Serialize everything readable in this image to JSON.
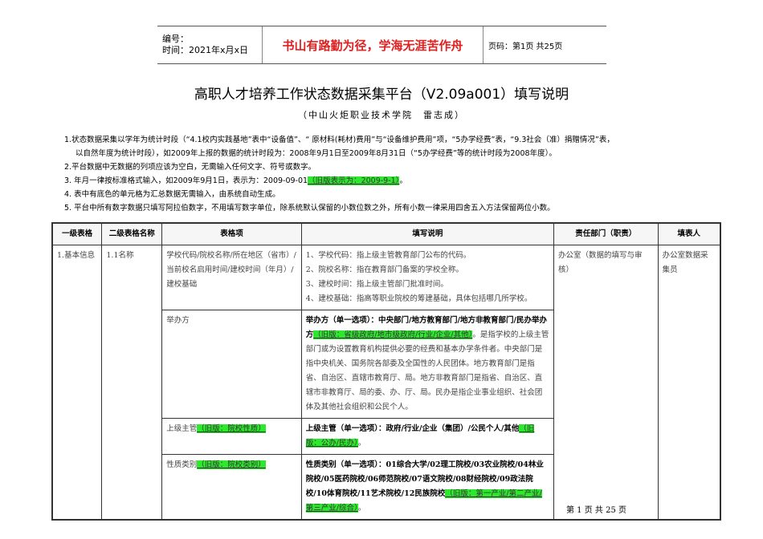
{
  "header": {
    "number_label": "编号：",
    "time_label": "时间：2021年x月x日",
    "motto": "书山有路勤为径，学海无涯苦作舟",
    "page_info": "页码：第1页  共25页"
  },
  "title": "高职人才培养工作状态数据采集平台（V2.09a001）填写说明",
  "subtitle": "（中山火炬职业技术学院　雷志成）",
  "notes": [
    "1.状态数据采集以学年为统计时段（“4.1校内实践基地”表中“设备值”、“ 原材料(耗材)费用”与“设备维护费用”项，“5办学经费”表，“9.3社会（准）捐赠情况”表，",
    "以自然年度为统计时段），如2009年上报的数据的统计时段为：2008年9月1日至2009年8月31日（“5办学经费”等的统计时段为2008年度）。",
    "2.平台数据中无数据的列项应该为空白，无需输入任何文字、符号或数字。",
    "3.  年月一律按标准格式输入，如2009年9月1日，表示为：2009-09-01",
    "（旧版表示为：2009-9-1）",
    "。",
    "4.  表中有底色的单元格为汇总数据无需输入，由系统自动生成。",
    "5.  平台中所有数字数据只填写阿拉伯数字，不用填写数字单位，除系统默认保留的小数位数之外，所有小数一律采用四舍五入方法保留两位小数。"
  ],
  "table": {
    "headers": [
      "一级表格",
      "二级表格名称",
      "表格项",
      "填写说明",
      "责任部门（职责）",
      "填表人"
    ],
    "level1": "1.基本信息",
    "level2": "1.1名称",
    "dept": "办公室（数据的填写与审核）",
    "filler": "办公室数据采集员",
    "rows": [
      {
        "item": "学校代码/院校名称/所在地区（省市）/当前校名启用时间/建校时间（年月）/建校基础",
        "desc": [
          "1、学校代码：指上级主管教育部门公布的代码。",
          "2、院校名称：指在教育部门备案的学校全称。",
          "3、建校时间：指上级主管部门批准时间。",
          "4、建校基础：指高等职业院校的筹建基础，具体包括哪几所学校。"
        ]
      },
      {
        "item": "举办方",
        "desc_bold": "举办方（单一选项）：中央部门/地方教育部门/地方非教育部门/民办举办方",
        "desc_hl": "（旧版：省级政府/地市级政府/行业/企业/其他）",
        "desc_rest": "。是指学校的上级主管部门或为设置教育机构提供必要的经费和基本办学条件者。中央部门是指中央机关、国务院各部委及全国性的人民团体。地方教育部门是指省、自治区、直辖市教育厅、局。地方非教育部门是指省、自治区、直辖市非教育厅、局的委、办、厅、局。民办是指企业事业组织、社会团体及其他社会组织和公民个人。"
      },
      {
        "item": "上级主管",
        "item_hl": "（旧版：院校性质）",
        "desc_bold": "上级主管（单一选项）：政府/行业/企业（集团）/公民个人/其他",
        "desc_hl": "（旧版：公办/民办）",
        "desc_rest": "。"
      },
      {
        "item": "性质类别",
        "item_hl": "（旧版：院校类别）",
        "desc_bold": "性质类别（单一选项）：01综合大学/02理工院校/03农业院校/04林业院校/05医药院校/06师范院校/07语文院校/08财经院校/09政法院校/10体育院校/11艺术院校/12民族院校",
        "desc_hl": "（旧版：第一产业/第二产业/第三产业/综合）",
        "desc_rest": "。"
      }
    ]
  },
  "footer": "第 1 页  共 25 页"
}
